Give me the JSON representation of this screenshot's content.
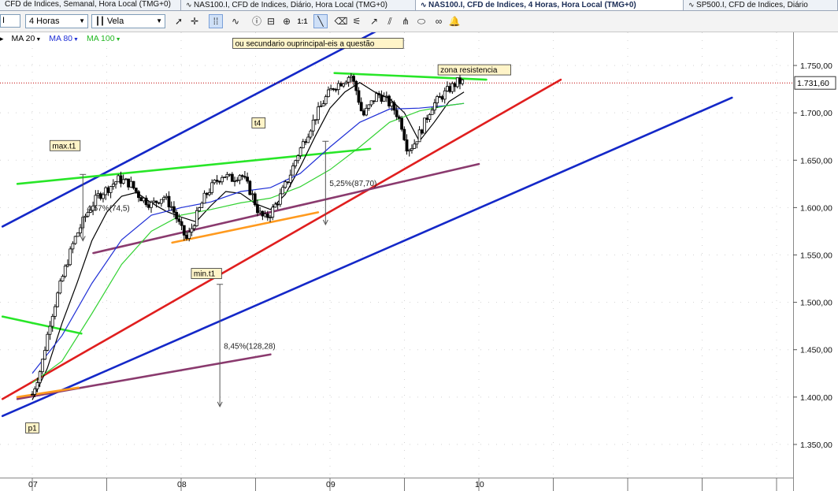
{
  "tabs": [
    {
      "label": "CFD de Indices, Semanal, Hora Local (TMG+0)",
      "active": false
    },
    {
      "label": "NAS100.I, CFD de Indices, Diário, Hora Local (TMG+0)",
      "active": false
    },
    {
      "label": "NAS100.I, CFD de Indices, 4 Horas, Hora Local (TMG+0)",
      "active": true
    },
    {
      "label": "SP500.I, CFD de Indices, Diário",
      "active": false
    }
  ],
  "toolbar": {
    "symbol_value": "I",
    "timeframe": "4 Horas",
    "chart_style": "Vela"
  },
  "indicators": [
    {
      "label": "MA 20",
      "color": "#000000"
    },
    {
      "label": "MA 80",
      "color": "#1f2fd6"
    },
    {
      "label": "MA 100",
      "color": "#32d232"
    }
  ],
  "colors": {
    "trend_blue": "#1428c8",
    "trend_red": "#e01e1e",
    "trend_green": "#28e628",
    "trend_purple": "#8a3a6e",
    "trend_orange": "#ff9a1e",
    "current_price_line": "#c00000"
  },
  "chart_data": {
    "type": "candlestick",
    "title": "",
    "y_axis": {
      "min": 1315,
      "max": 1785,
      "ticks": [
        "1.750,00",
        "1.700,00",
        "1.650,00",
        "1.600,00",
        "1.550,00",
        "1.500,00",
        "1.450,00",
        "1.400,00",
        "1.350,00"
      ],
      "tick_values": [
        1750,
        1700,
        1650,
        1600,
        1550,
        1500,
        1450,
        1400,
        1350
      ]
    },
    "x_axis": {
      "labels": [
        "07",
        "08",
        "09",
        "10"
      ],
      "label_positions_days": [
        0,
        1,
        2,
        3
      ]
    },
    "current_price": {
      "value": 1731.6,
      "label": "1.731,60"
    },
    "close_path": [
      [
        0.0,
        1403
      ],
      [
        0.06,
        1432
      ],
      [
        0.12,
        1480
      ],
      [
        0.2,
        1525
      ],
      [
        0.28,
        1565
      ],
      [
        0.36,
        1592
      ],
      [
        0.44,
        1612
      ],
      [
        0.52,
        1622
      ],
      [
        0.58,
        1630
      ],
      [
        0.66,
        1625
      ],
      [
        0.72,
        1612
      ],
      [
        0.8,
        1603
      ],
      [
        0.88,
        1612
      ],
      [
        0.94,
        1600
      ],
      [
        1.0,
        1577
      ],
      [
        1.04,
        1566
      ],
      [
        1.1,
        1590
      ],
      [
        1.16,
        1612
      ],
      [
        1.22,
        1625
      ],
      [
        1.28,
        1635
      ],
      [
        1.34,
        1630
      ],
      [
        1.4,
        1636
      ],
      [
        1.44,
        1625
      ],
      [
        1.48,
        1612
      ],
      [
        1.52,
        1595
      ],
      [
        1.56,
        1588
      ],
      [
        1.6,
        1594
      ],
      [
        1.66,
        1610
      ],
      [
        1.72,
        1630
      ],
      [
        1.78,
        1655
      ],
      [
        1.84,
        1675
      ],
      [
        1.9,
        1695
      ],
      [
        1.96,
        1713
      ],
      [
        2.02,
        1727
      ],
      [
        2.08,
        1733
      ],
      [
        2.14,
        1740
      ],
      [
        2.18,
        1722
      ],
      [
        2.22,
        1696
      ],
      [
        2.26,
        1706
      ],
      [
        2.32,
        1720
      ],
      [
        2.38,
        1713
      ],
      [
        2.44,
        1702
      ],
      [
        2.48,
        1688
      ],
      [
        2.52,
        1662
      ],
      [
        2.56,
        1666
      ],
      [
        2.62,
        1684
      ],
      [
        2.68,
        1706
      ],
      [
        2.74,
        1716
      ],
      [
        2.8,
        1725
      ],
      [
        2.86,
        1733
      ],
      [
        2.9,
        1732
      ]
    ],
    "moving_averages": {
      "MA 20": [
        [
          0.0,
          1397
        ],
        [
          0.1,
          1430
        ],
        [
          0.2,
          1478
        ],
        [
          0.3,
          1520
        ],
        [
          0.4,
          1565
        ],
        [
          0.5,
          1595
        ],
        [
          0.6,
          1612
        ],
        [
          0.7,
          1616
        ],
        [
          0.8,
          1605
        ],
        [
          0.9,
          1596
        ],
        [
          1.0,
          1590
        ],
        [
          1.1,
          1585
        ],
        [
          1.2,
          1602
        ],
        [
          1.3,
          1617
        ],
        [
          1.4,
          1615
        ],
        [
          1.5,
          1604
        ],
        [
          1.6,
          1598
        ],
        [
          1.7,
          1614
        ],
        [
          1.8,
          1643
        ],
        [
          1.9,
          1675
        ],
        [
          2.0,
          1705
        ],
        [
          2.1,
          1722
        ],
        [
          2.2,
          1732
        ],
        [
          2.3,
          1722
        ],
        [
          2.4,
          1715
        ],
        [
          2.5,
          1700
        ],
        [
          2.6,
          1670
        ],
        [
          2.7,
          1690
        ],
        [
          2.8,
          1712
        ],
        [
          2.9,
          1722
        ]
      ],
      "MA 80": [
        [
          0.0,
          1425
        ],
        [
          0.2,
          1465
        ],
        [
          0.4,
          1520
        ],
        [
          0.6,
          1566
        ],
        [
          0.8,
          1592
        ],
        [
          1.0,
          1600
        ],
        [
          1.2,
          1606
        ],
        [
          1.4,
          1617
        ],
        [
          1.6,
          1621
        ],
        [
          1.8,
          1636
        ],
        [
          2.0,
          1664
        ],
        [
          2.2,
          1690
        ],
        [
          2.4,
          1704
        ],
        [
          2.6,
          1705
        ],
        [
          2.8,
          1708
        ],
        [
          2.9,
          1710
        ]
      ],
      "MA 100": [
        [
          0.0,
          1415
        ],
        [
          0.2,
          1438
        ],
        [
          0.4,
          1488
        ],
        [
          0.6,
          1540
        ],
        [
          0.8,
          1575
        ],
        [
          1.0,
          1592
        ],
        [
          1.2,
          1598
        ],
        [
          1.4,
          1605
        ],
        [
          1.6,
          1610
        ],
        [
          1.8,
          1622
        ],
        [
          2.0,
          1640
        ],
        [
          2.2,
          1664
        ],
        [
          2.4,
          1690
        ],
        [
          2.6,
          1702
        ],
        [
          2.8,
          1708
        ],
        [
          2.9,
          1710
        ]
      ]
    },
    "trendlines": [
      {
        "color": "blue",
        "from": [
          -0.2,
          1580
        ],
        "to": [
          2.6,
          1810
        ]
      },
      {
        "color": "blue",
        "from": [
          -0.2,
          1380
        ],
        "to": [
          4.7,
          1716
        ]
      },
      {
        "color": "red",
        "from": [
          -0.2,
          1398
        ],
        "to": [
          3.55,
          1735
        ]
      },
      {
        "color": "green",
        "from": [
          -0.1,
          1625
        ],
        "to": [
          2.27,
          1662
        ]
      },
      {
        "color": "green",
        "from": [
          2.03,
          1742
        ],
        "to": [
          3.05,
          1735
        ]
      },
      {
        "color": "green",
        "from": [
          -0.2,
          1485
        ],
        "to": [
          0.33,
          1467
        ]
      },
      {
        "color": "purple",
        "from": [
          0.41,
          1552
        ],
        "to": [
          3.0,
          1646
        ]
      },
      {
        "color": "purple",
        "from": [
          -0.1,
          1398
        ],
        "to": [
          1.6,
          1445
        ]
      },
      {
        "color": "orange",
        "from": [
          0.94,
          1563
        ],
        "to": [
          1.92,
          1595
        ]
      },
      {
        "color": "orange",
        "from": [
          -0.1,
          1400
        ],
        "to": [
          0.31,
          1410
        ]
      }
    ],
    "measures": [
      {
        "x": 0.34,
        "from": 1635,
        "to": 1565,
        "label": "4,57%(74,5)"
      },
      {
        "x": 1.97,
        "from": 1670,
        "to": 1582,
        "label": "5,25%(87,70)"
      },
      {
        "x": 1.26,
        "from": 1519,
        "to": 1390,
        "label": "8,45%(128,28)"
      }
    ],
    "annotations": [
      {
        "text": "ou secundario ouprincipal-eis a questão",
        "at": [
          1.92,
          1773
        ]
      },
      {
        "text": "zona resistencia",
        "at": [
          2.97,
          1745
        ]
      },
      {
        "text": "max.t1",
        "at": [
          0.22,
          1665
        ]
      },
      {
        "text": "min.t1",
        "at": [
          1.17,
          1530
        ]
      },
      {
        "text": "t4",
        "at": [
          1.52,
          1689
        ]
      },
      {
        "text": "p1",
        "at": [
          0.0,
          1367
        ]
      }
    ]
  }
}
